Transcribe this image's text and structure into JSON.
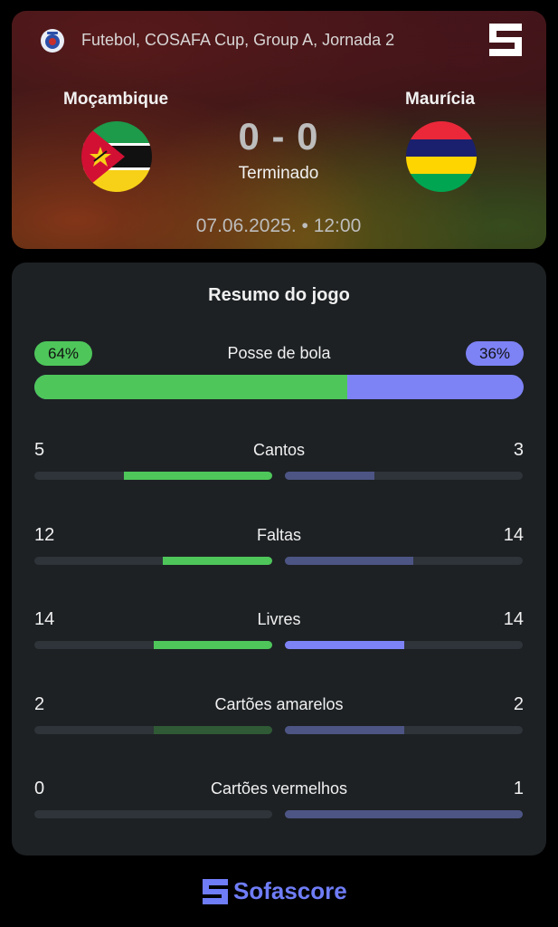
{
  "header": {
    "competition": "Futebol, COSAFA Cup, Group A, Jornada 2",
    "home_team": "Moçambique",
    "away_team": "Maurícia",
    "score": "0 - 0",
    "status": "Terminado",
    "datetime": "07.06.2025. • 12:00"
  },
  "summary": {
    "title": "Resumo do jogo",
    "possession": {
      "label": "Posse de bola",
      "home": "64%",
      "away": "36%",
      "home_fraction": 0.64
    },
    "stats": [
      {
        "label": "Cantos",
        "home": "5",
        "away": "3",
        "home_fill": 0.625,
        "away_fill": 0.375
      },
      {
        "label": "Faltas",
        "home": "12",
        "away": "14",
        "home_fill": 0.46,
        "away_fill": 0.54
      },
      {
        "label": "Livres",
        "home": "14",
        "away": "14",
        "home_fill": 0.5,
        "away_fill": 0.5
      },
      {
        "label": "Cartões amarelos",
        "home": "2",
        "away": "2",
        "home_fill": 0.5,
        "away_fill": 0.5
      },
      {
        "label": "Cartões vermelhos",
        "home": "0",
        "away": "1",
        "home_fill": 0,
        "away_fill": 1
      }
    ]
  },
  "footer": {
    "brand": "Sofascore"
  },
  "colors": {
    "home": "#4ec65a",
    "away": "#7d82f5",
    "card": "#1d2124"
  },
  "icons": {
    "competition": "cosafa-badge-icon",
    "brand": "sofascore-logo-icon"
  }
}
